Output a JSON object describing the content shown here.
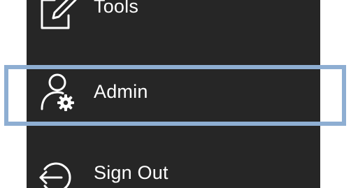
{
  "menu": {
    "items": [
      {
        "label": "Tools",
        "icon": "edit-document-icon"
      },
      {
        "label": "Admin",
        "icon": "user-settings-icon"
      },
      {
        "label": "Sign Out",
        "icon": "sign-out-icon"
      }
    ],
    "background_color": "#262626",
    "text_color": "#ffffff"
  },
  "highlight": {
    "target": "Admin",
    "color": "#8eaed2"
  }
}
